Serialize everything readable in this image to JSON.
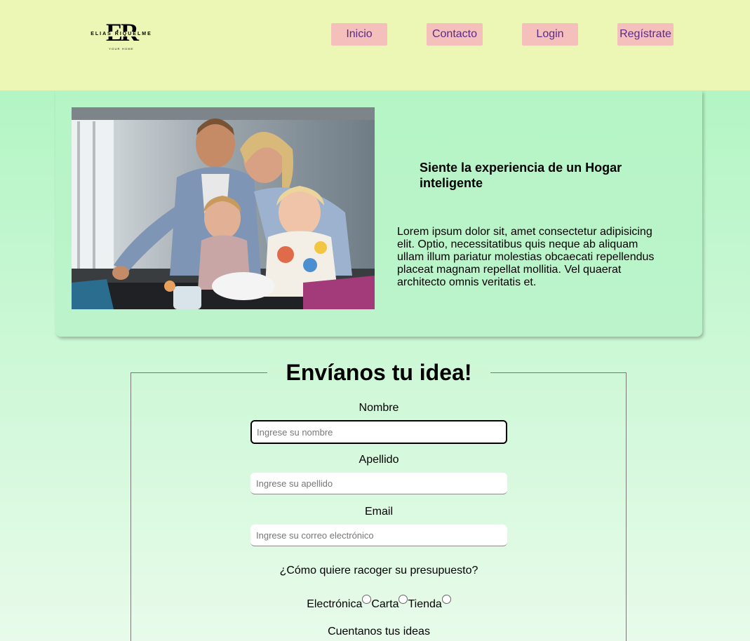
{
  "brand": {
    "mark": "ER",
    "name": "ELIAS RIQUELME",
    "tagline": "YOUR HOME"
  },
  "nav": {
    "items": [
      {
        "label": "Inicio"
      },
      {
        "label": "Contacto"
      },
      {
        "label": "Login"
      },
      {
        "label": "Regístrate"
      }
    ]
  },
  "hero": {
    "title": "Siente la experiencia de un Hogar inteligente",
    "text": "Lorem ipsum dolor sit, amet consectetur adipisicing elit. Optio, necessitatibus quis neque ab aliquam ullam illum pariatur molestias obcaecati repellendus placeat magnam repellat mollitia. Vel quaerat architecto omnis veritatis et."
  },
  "form": {
    "legend": "Envíanos tu idea!",
    "nombre": {
      "label": "Nombre",
      "placeholder": "Ingrese su nombre",
      "value": ""
    },
    "apellido": {
      "label": "Apellido",
      "placeholder": "Ingrese su apellido",
      "value": ""
    },
    "email": {
      "label": "Email",
      "placeholder": "Ingrese su correo electrónico",
      "value": ""
    },
    "presupuesto": {
      "question": "¿Cómo quiere racoger su presupuesto?",
      "options": [
        "Electrónica",
        "Carta",
        "Tienda"
      ]
    },
    "ideas": {
      "label": "Cuentanos tus ideas"
    }
  },
  "colors": {
    "header_bg": "#ecf7b5",
    "nav_button_bg": "#f5c0bb",
    "nav_text": "#5a2a86",
    "page_bg": "#b3f5c4"
  }
}
